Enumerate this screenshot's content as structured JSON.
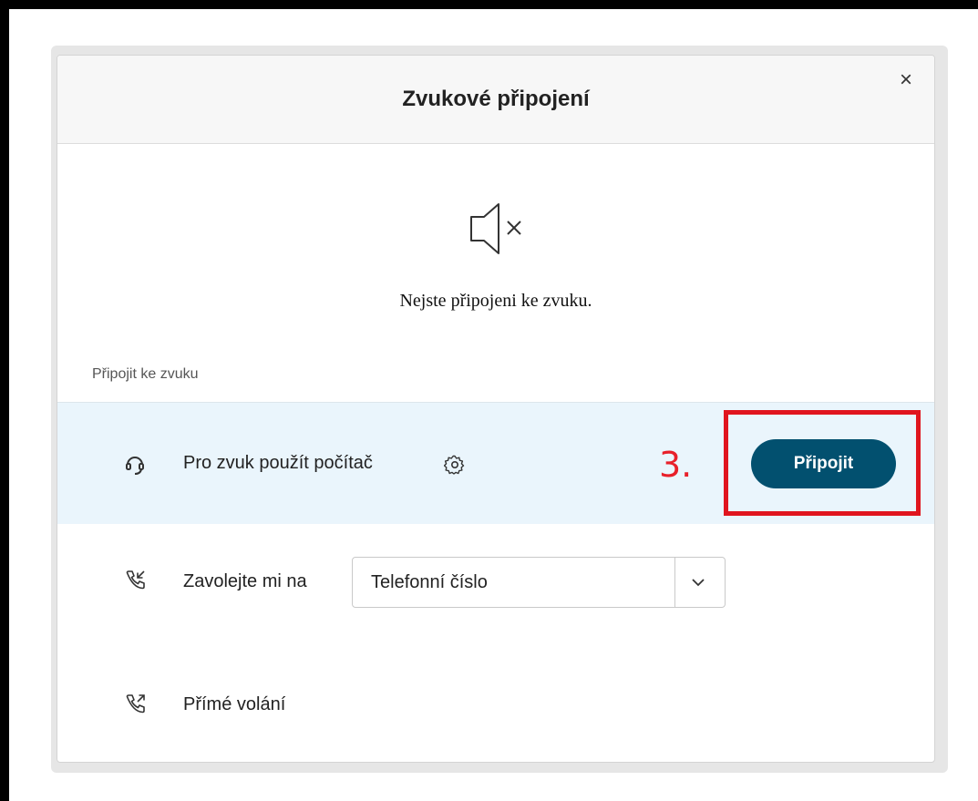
{
  "dialog": {
    "title": "Zvukové připojení",
    "close_label": "×",
    "status_message": "Nejste připojeni ke zvuku.",
    "section_label": "Připojit ke zvuku"
  },
  "options": {
    "computer": {
      "label": "Pro zvuk použít počítač",
      "button_label": "Připojit"
    },
    "call_me": {
      "label": "Zavolejte mi na",
      "select_value": "Telefonní číslo"
    },
    "direct_call": {
      "label": "Přímé volání"
    }
  },
  "annotation": {
    "step_number": "3.",
    "color": "#e0151e"
  },
  "colors": {
    "button_bg": "#02506f",
    "highlight_row": "#eaf5fc"
  },
  "icons": [
    "muted-speaker-icon",
    "headset-icon",
    "gear-icon",
    "incoming-call-icon",
    "outgoing-call-icon",
    "chevron-down-icon",
    "close-icon"
  ]
}
